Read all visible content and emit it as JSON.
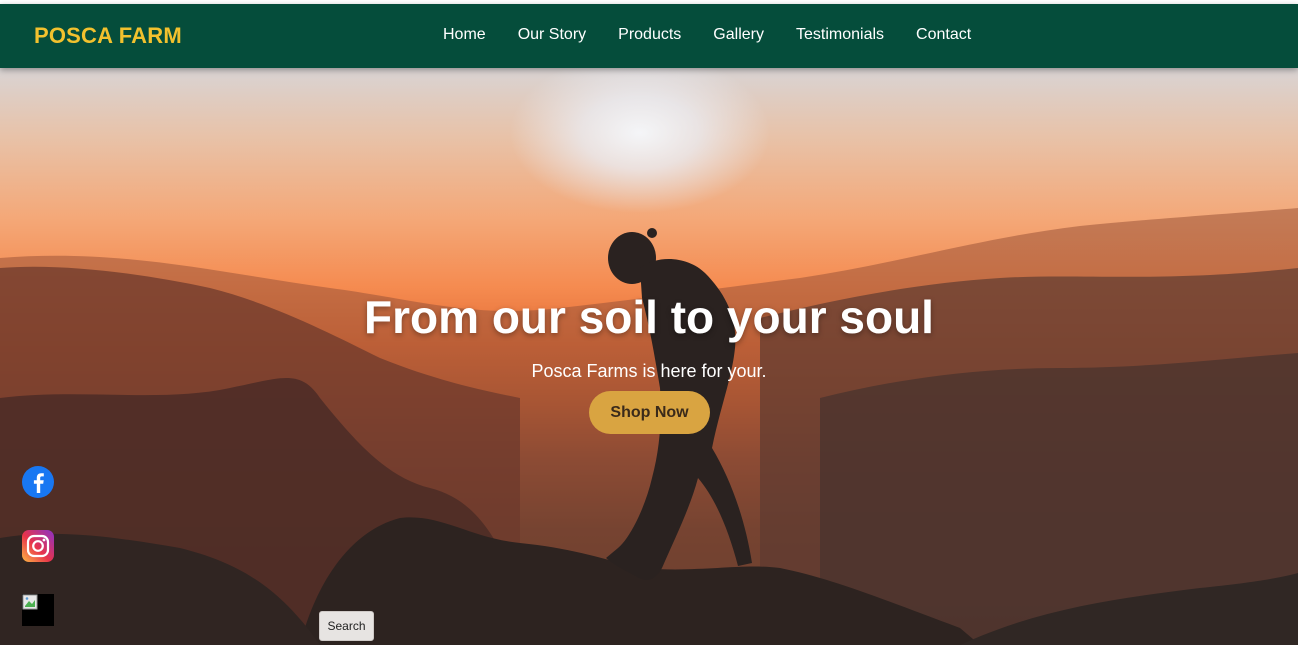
{
  "header": {
    "brand": "POSCA FARM",
    "nav": [
      {
        "label": "Home"
      },
      {
        "label": "Our Story"
      },
      {
        "label": "Products"
      },
      {
        "label": "Gallery"
      },
      {
        "label": "Testimonials"
      },
      {
        "label": "Contact"
      }
    ]
  },
  "hero": {
    "title": "From our soil to your soul",
    "subtitle": "Posca Farms is here for your.",
    "cta_label": "Shop Now"
  },
  "social": [
    {
      "name": "facebook-icon"
    },
    {
      "name": "instagram-icon"
    },
    {
      "name": "broken-image-icon"
    }
  ],
  "search": {
    "label": "Search"
  },
  "colors": {
    "navbar": "#054d3b",
    "brand": "#f2c12e",
    "cta": "#d9a441"
  }
}
